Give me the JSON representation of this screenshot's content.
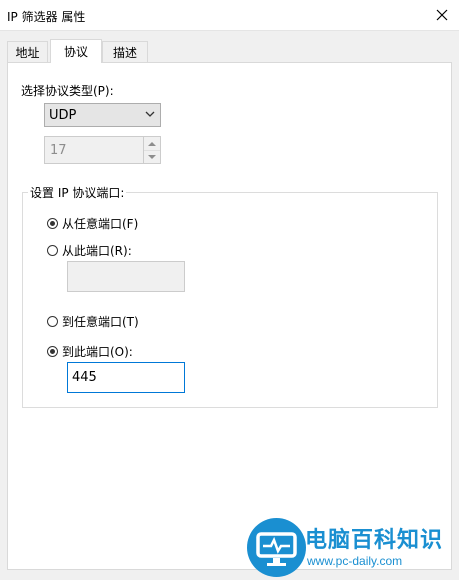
{
  "window": {
    "title": "IP 筛选器 属性"
  },
  "tabs": [
    {
      "label": "地址"
    },
    {
      "label": "协议"
    },
    {
      "label": "描述"
    }
  ],
  "protocol": {
    "type_label": "选择协议类型(P):",
    "selected": "UDP",
    "number_value": "17"
  },
  "ports": {
    "legend": "设置 IP 协议端口:",
    "from_any_label": "从任意端口(F)",
    "from_this_label": "从此端口(R):",
    "from_this_value": "",
    "to_any_label": "到任意端口(T)",
    "to_this_label": "到此端口(O):",
    "to_this_value": "445",
    "from_selected": "any",
    "to_selected": "this"
  },
  "watermark": {
    "title": "电脑百科知识",
    "url": "www.pc-daily.com"
  },
  "colors": {
    "accent": "#0078d7",
    "watermark": "#1a8fd1"
  }
}
